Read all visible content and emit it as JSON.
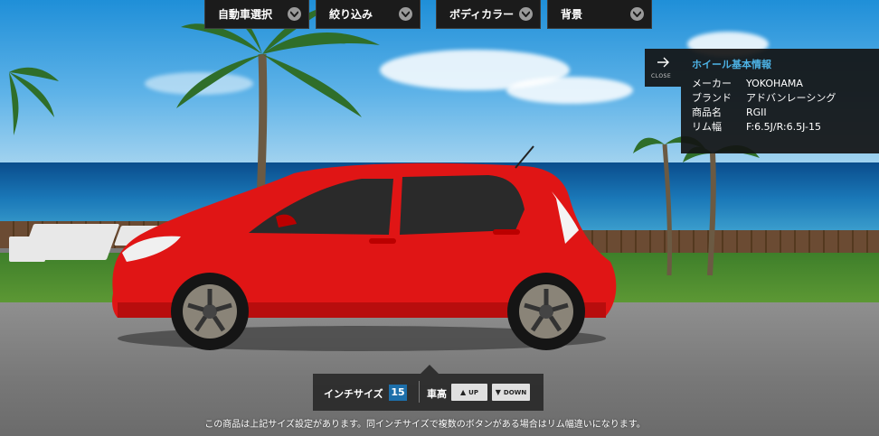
{
  "menu": [
    {
      "label": "自動車選択"
    },
    {
      "label": "絞り込み"
    },
    {
      "label": "ボディカラー"
    },
    {
      "label": "背景"
    }
  ],
  "info": {
    "close_label": "CLOSE",
    "title": "ホイール基本情報",
    "rows": [
      {
        "key": "メーカー",
        "value": "YOKOHAMA"
      },
      {
        "key": "ブランド",
        "value": "アドバンレーシング"
      },
      {
        "key": "商品名",
        "value": "RGII"
      },
      {
        "key": "リム幅",
        "value": "F:6.5J/R:6.5J-15"
      }
    ]
  },
  "control": {
    "inch_label": "インチサイズ",
    "inch_value": "15",
    "height_label": "車高",
    "up_label": "UP",
    "down_label": "DOWN"
  },
  "note": "この商品は上記サイズ設定があります。同インチサイズで複数のボタンがある場合はリム幅違いになります。",
  "colors": {
    "accent": "#4db3e6",
    "inch_badge": "#1d6faa",
    "car_body": "#e01515"
  },
  "icons": {
    "close": "arrow-right-icon",
    "dropdown": "chevron-down-icon",
    "up": "triangle-up-icon",
    "down": "triangle-down-icon"
  }
}
